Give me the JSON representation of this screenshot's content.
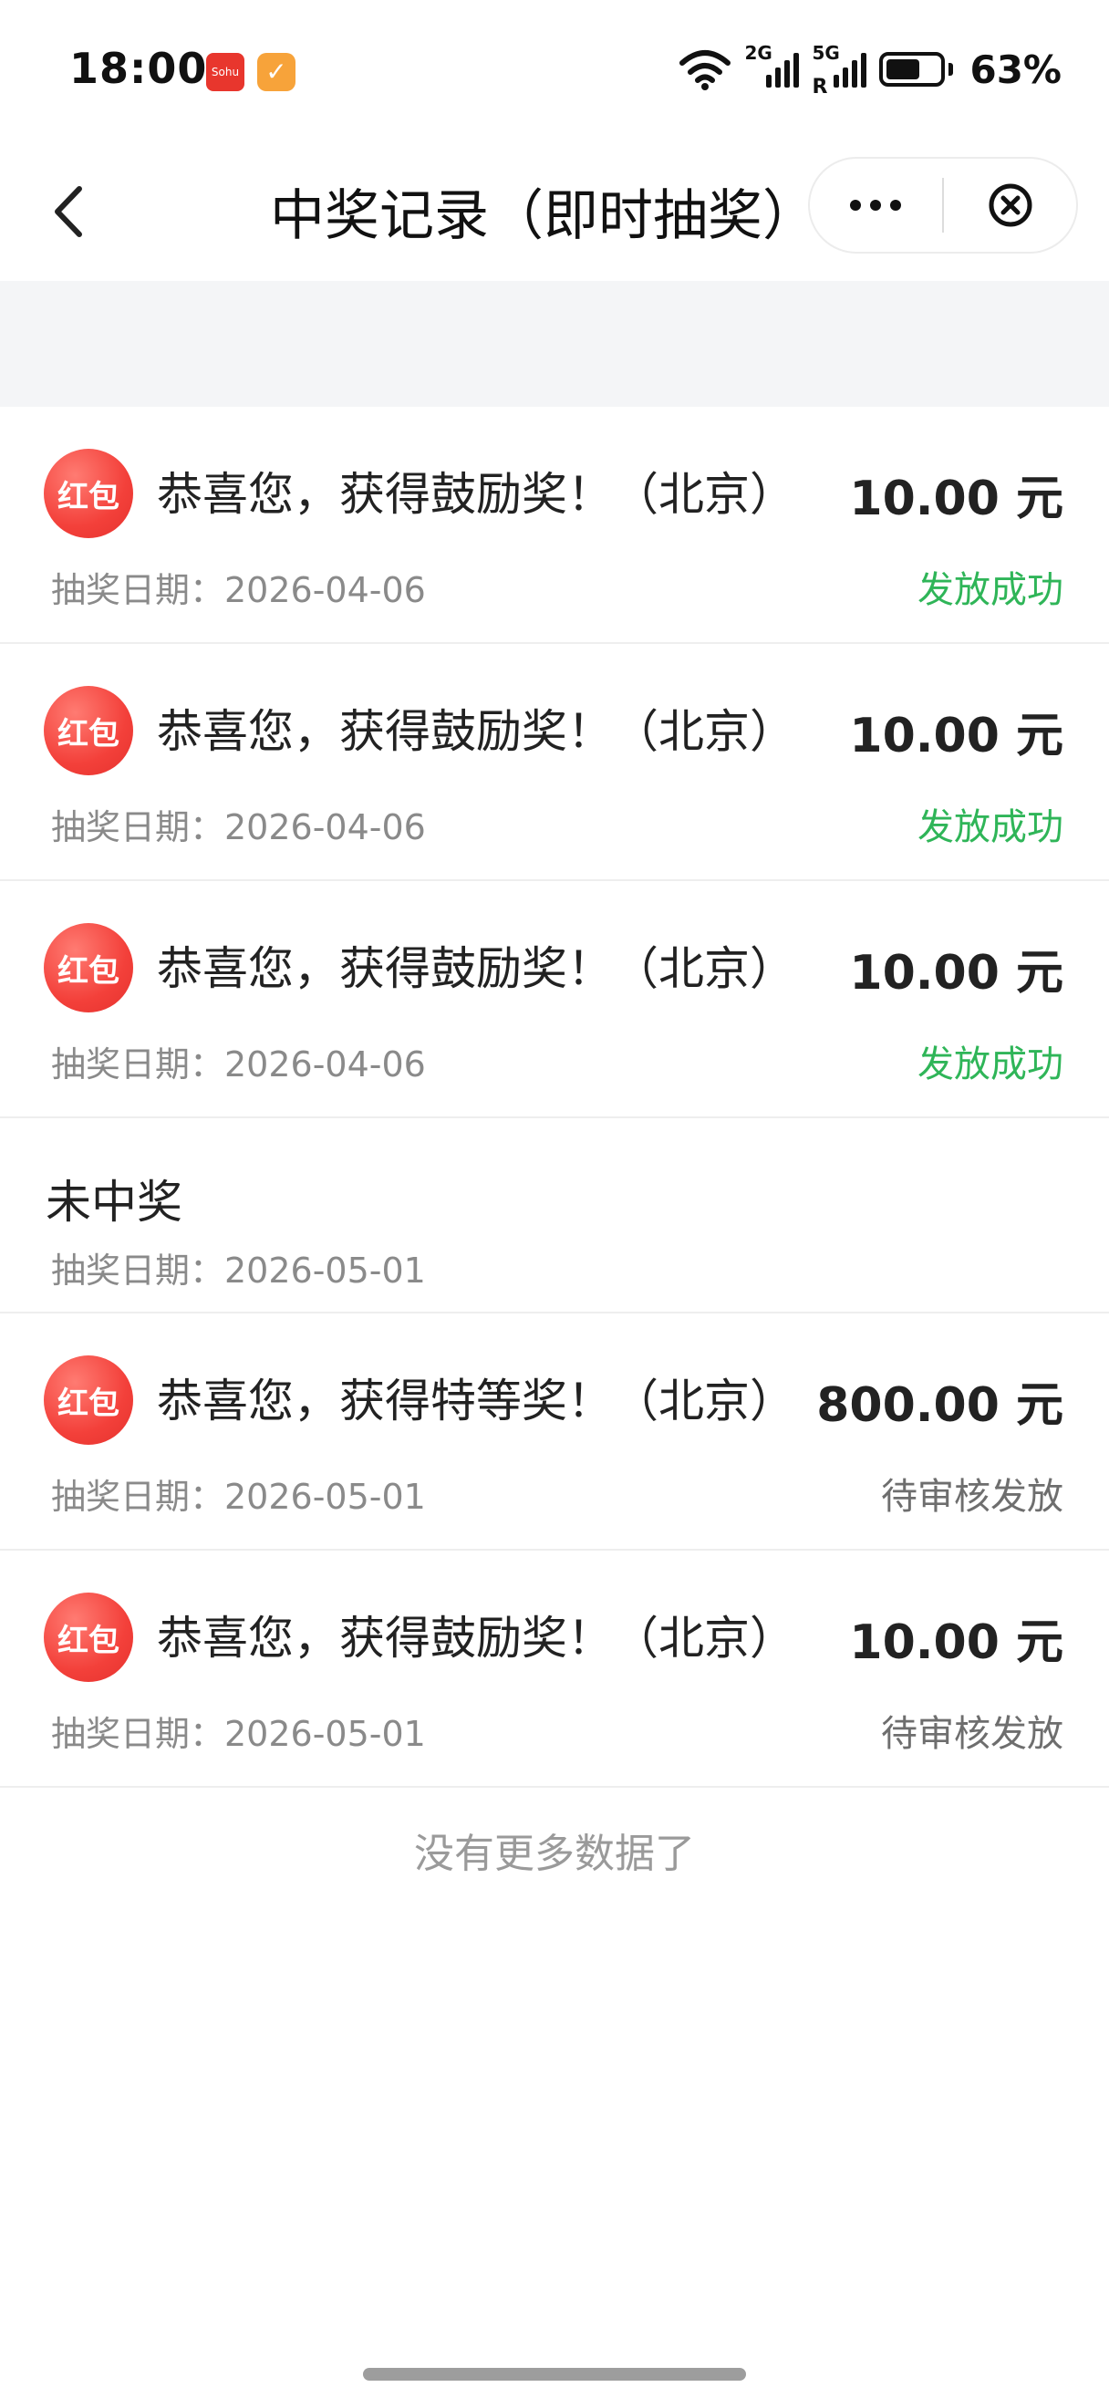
{
  "status_bar": {
    "time": "18:00",
    "app_icon_1_text": "Sohu",
    "app_icon_2_text": "✓",
    "net_1": "2G",
    "net_2": "5G",
    "net_2_roaming": "R",
    "battery_level": 0.63,
    "battery_pct": "63%"
  },
  "nav": {
    "title": "中奖记录（即时抽奖）",
    "icons": {
      "back": "chevron-left-icon",
      "more": "more-dots-icon",
      "close": "close-circle-icon"
    }
  },
  "records": [
    {
      "badge": "红包",
      "title": "恭喜您，获得鼓励奖！（北京）",
      "amount": "10.00 元",
      "date": "抽奖日期：2026-04-06",
      "status": "发放成功",
      "status_type": "success"
    },
    {
      "badge": "红包",
      "title": "恭喜您，获得鼓励奖！（北京）",
      "amount": "10.00 元",
      "date": "抽奖日期：2026-04-06",
      "status": "发放成功",
      "status_type": "success"
    },
    {
      "badge": "红包",
      "title": "恭喜您，获得鼓励奖！（北京）",
      "amount": "10.00 元",
      "date": "抽奖日期：2026-04-06",
      "status": "发放成功",
      "status_type": "success"
    },
    {
      "title": "未中奖",
      "date": "抽奖日期：2026-05-01"
    },
    {
      "badge": "红包",
      "title": "恭喜您，获得特等奖！（北京）",
      "amount": "800.00 元",
      "date": "抽奖日期：2026-05-01",
      "status": "待审核发放",
      "status_type": "pending"
    },
    {
      "badge": "红包",
      "title": "恭喜您，获得鼓励奖！（北京）",
      "amount": "10.00 元",
      "date": "抽奖日期：2026-05-01",
      "status": "待审核发放",
      "status_type": "pending"
    }
  ],
  "footer": {
    "no_more": "没有更多数据了"
  },
  "colors": {
    "badge_red": "#f3403a",
    "success_green": "#2fb558",
    "pending_gray": "#6e6e6e",
    "band_gray": "#f4f5f7"
  }
}
